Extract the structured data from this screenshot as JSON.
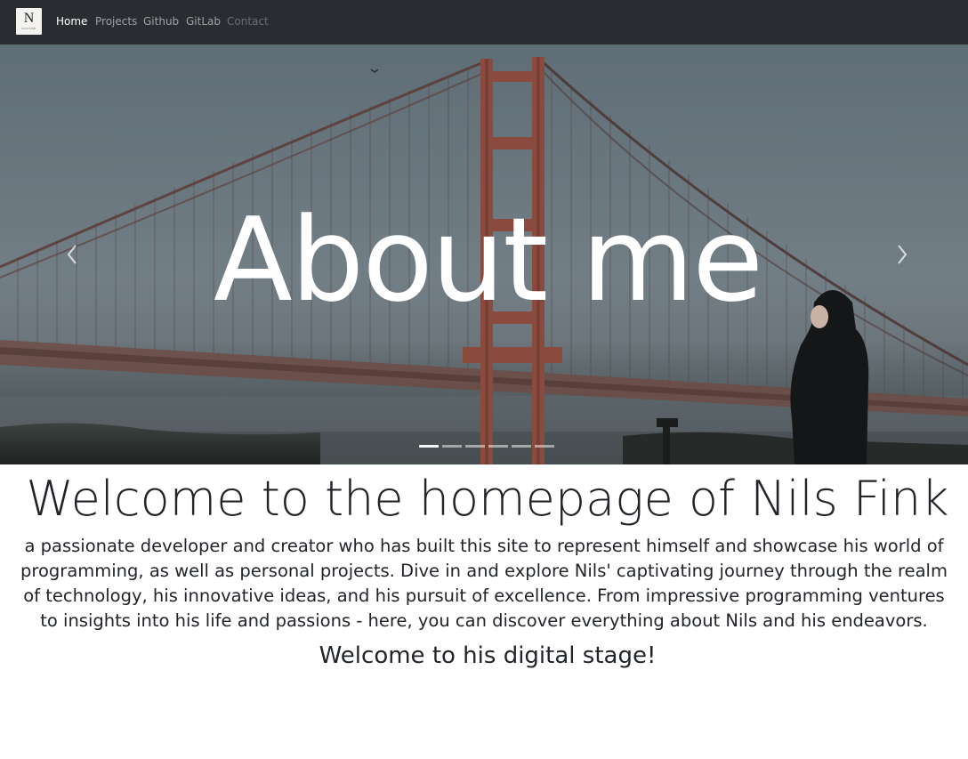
{
  "nav": {
    "brand_letter": "N",
    "brand_subtext": "NILS FINK",
    "items": [
      {
        "label": "Home",
        "state": "active"
      },
      {
        "label": "Projects",
        "state": "normal"
      },
      {
        "label": "Github",
        "state": "normal"
      },
      {
        "label": "GitLab",
        "state": "normal"
      },
      {
        "label": "Contact",
        "state": "disabled"
      }
    ]
  },
  "hero": {
    "title": "About me",
    "prev_icon": "chevron-left-icon",
    "next_icon": "chevron-right-icon",
    "slide_count": 6,
    "active_slide": 1
  },
  "content": {
    "heading": "Welcome to the homepage of Nils Fink",
    "intro_lines": [
      "a passionate developer and creator who has built this site to represent himself and showcase his world of",
      "programming, as well as personal projects. Dive in and explore Nils' captivating journey through the realm",
      "of technology, his innovative ideas, and his pursuit of excellence. From impressive programming ventures",
      "to insights into his life and passions - here, you can discover everything about Nils and his endeavors."
    ],
    "closing": "Welcome to his digital stage!"
  },
  "colors": {
    "navbar_bg": "#292d31",
    "text_dark": "#212529",
    "bridge_red": "#8a4a3e"
  }
}
